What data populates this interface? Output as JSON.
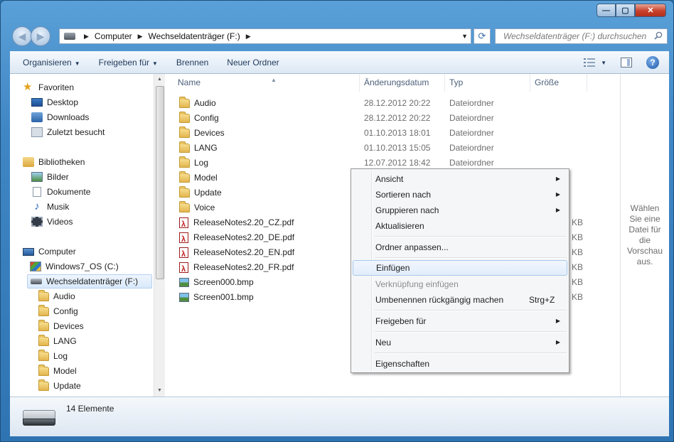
{
  "window": {
    "caption": {
      "minimize": "—",
      "maximize": "▢",
      "close": "✕"
    }
  },
  "nav": {
    "breadcrumb": [
      "Computer",
      "Wechseldatenträger (F:)"
    ],
    "search_placeholder": "Wechseldatenträger (F:) durchsuchen"
  },
  "toolbar": {
    "organize": "Organisieren",
    "share": "Freigeben für",
    "burn": "Brennen",
    "new_folder": "Neuer Ordner"
  },
  "sidebar": {
    "favorites": {
      "label": "Favoriten",
      "items": [
        "Desktop",
        "Downloads",
        "Zuletzt besucht"
      ]
    },
    "libraries": {
      "label": "Bibliotheken",
      "items": [
        "Bilder",
        "Dokumente",
        "Musik",
        "Videos"
      ]
    },
    "computer": {
      "label": "Computer",
      "items": [
        "Windows7_OS (C:)",
        "Wechseldatenträger (F:)"
      ]
    },
    "subfolders": [
      "Audio",
      "Config",
      "Devices",
      "LANG",
      "Log",
      "Model",
      "Update"
    ]
  },
  "columns": [
    "Name",
    "Änderungsdatum",
    "Typ",
    "Größe"
  ],
  "files": [
    {
      "name": "Audio",
      "date": "28.12.2012 20:22",
      "type": "Dateiordner",
      "size": ""
    },
    {
      "name": "Config",
      "date": "28.12.2012 20:22",
      "type": "Dateiordner",
      "size": ""
    },
    {
      "name": "Devices",
      "date": "01.10.2013 18:01",
      "type": "Dateiordner",
      "size": ""
    },
    {
      "name": "LANG",
      "date": "01.10.2013 15:05",
      "type": "Dateiordner",
      "size": ""
    },
    {
      "name": "Log",
      "date": "12.07.2012 18:42",
      "type": "Dateiordner",
      "size": ""
    },
    {
      "name": "Model",
      "date": "",
      "type": "",
      "size": ""
    },
    {
      "name": "Update",
      "date": "",
      "type": "",
      "size": ""
    },
    {
      "name": "Voice",
      "date": "",
      "type": "",
      "size": ""
    },
    {
      "name": "ReleaseNotes2.20_CZ.pdf",
      "date": "",
      "type": "",
      "size": "KB"
    },
    {
      "name": "ReleaseNotes2.20_DE.pdf",
      "date": "",
      "type": "",
      "size": "KB"
    },
    {
      "name": "ReleaseNotes2.20_EN.pdf",
      "date": "",
      "type": "",
      "size": "KB"
    },
    {
      "name": "ReleaseNotes2.20_FR.pdf",
      "date": "",
      "type": "",
      "size": "KB"
    },
    {
      "name": "Screen000.bmp",
      "date": "",
      "type": "",
      "size": "KB"
    },
    {
      "name": "Screen001.bmp",
      "date": "",
      "type": "",
      "size": "KB"
    }
  ],
  "preview_text": "Wählen Sie eine Datei für die Vorschau aus.",
  "status": {
    "count": "14 Elemente"
  },
  "context_menu": {
    "view": "Ansicht",
    "sort": "Sortieren nach",
    "group": "Gruppieren nach",
    "refresh": "Aktualisieren",
    "customize": "Ordner anpassen...",
    "paste": "Einfügen",
    "paste_shortcut": "Verknüpfung einfügen",
    "undo_rename": "Umbenennen rückgängig machen",
    "undo_shortcut": "Strg+Z",
    "share": "Freigeben für",
    "new": "Neu",
    "properties": "Eigenschaften"
  }
}
